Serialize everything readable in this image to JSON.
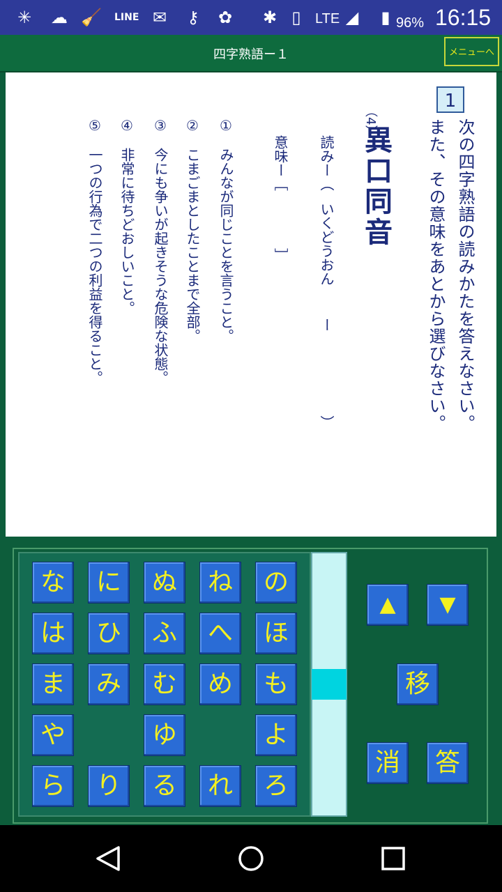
{
  "status_bar": {
    "time": "16:15",
    "battery": "96%",
    "network": "LTE",
    "left_icons": [
      "loading-icon",
      "cloud-notify-icon",
      "broom-icon",
      "line-icon",
      "mail-icon",
      "key-icon",
      "flower-icon"
    ],
    "right_icons": [
      "bluetooth-icon",
      "vibrate-icon",
      "signal-icon",
      "battery-icon"
    ]
  },
  "header": {
    "title": "四字熟語ー１",
    "menu_label": "メニューへ"
  },
  "question": {
    "number": "1",
    "instruction_line1": "次の四字熟語の読みかたを答えなさい。",
    "instruction_line2": "また、その意味をあとから選びなさい。",
    "sub_number": "（4）",
    "idiom": "異口同音",
    "reading_label": "読みー（",
    "reading_answer": "いくどうおん",
    "reading_dash": "ー",
    "reading_close": "）",
    "meaning_label": "意味ー［",
    "meaning_close": "］",
    "options": [
      "①　みんなが同じことを言うこと。",
      "②　こまごまとしたことまで全部。",
      "③　今にも争いが起きそうな危険な状態。",
      "④　非常に待ちどおしいこと。",
      "⑤　一つの行為で二つの利益を得ること。"
    ]
  },
  "keyboard": {
    "rows": [
      [
        "な",
        "に",
        "ぬ",
        "ね",
        "の"
      ],
      [
        "は",
        "ひ",
        "ふ",
        "へ",
        "ほ"
      ],
      [
        "ま",
        "み",
        "む",
        "め",
        "も"
      ],
      [
        "や",
        "",
        "ゆ",
        "",
        "よ"
      ],
      [
        "ら",
        "り",
        "る",
        "れ",
        "ろ"
      ]
    ],
    "controls": {
      "up": "▲",
      "down": "▼",
      "move": "移",
      "delete": "消",
      "answer": "答"
    }
  },
  "colors": {
    "status_bar": "#2e3a99",
    "background": "#0d5d3b",
    "key": "#2a6cd6",
    "key_text": "#f4f020",
    "text_blue": "#1b2a7a",
    "scroll_thumb": "#00d4e0"
  }
}
